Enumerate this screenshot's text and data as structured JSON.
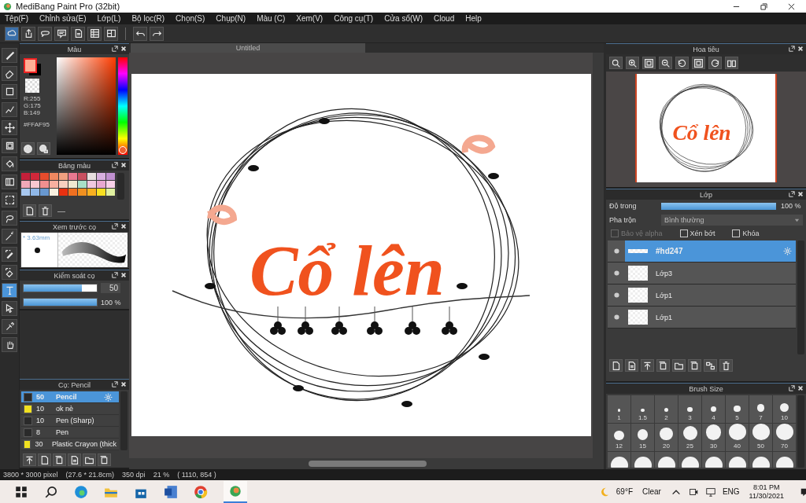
{
  "window": {
    "title": "MediBang Paint Pro (32bit)"
  },
  "menu": [
    "Tệp(F)",
    "Chỉnh sửa(E)",
    "Lớp(L)",
    "Bộ lọc(R)",
    "Chọn(S)",
    "Chụp(N)",
    "Màu (C)",
    "Xem(V)",
    "Công cụ(T)",
    "Cửa sổ(W)",
    "Cloud",
    "Help"
  ],
  "tools": [
    {
      "kind": "brush",
      "selected": false
    },
    {
      "kind": "eraser",
      "selected": false
    },
    {
      "kind": "rect",
      "selected": false
    },
    {
      "kind": "polyline",
      "selected": false
    },
    {
      "kind": "move",
      "selected": false
    },
    {
      "kind": "fillrect",
      "selected": false
    },
    {
      "kind": "bucket",
      "selected": false
    },
    {
      "kind": "gradient",
      "selected": false
    },
    {
      "kind": "selectrect",
      "selected": false
    },
    {
      "kind": "lasso",
      "selected": false
    },
    {
      "kind": "wand",
      "selected": false
    },
    {
      "kind": "selectpen",
      "selected": false
    },
    {
      "kind": "selecteraser",
      "selected": false
    },
    {
      "kind": "text",
      "selected": true
    },
    {
      "kind": "operation",
      "selected": false
    },
    {
      "kind": "dropper",
      "selected": false
    },
    {
      "kind": "hand",
      "selected": false
    }
  ],
  "color_panel": {
    "title": "Màu",
    "color": "#ffaf95",
    "r": "R:255",
    "g": "G:175",
    "b": "B:149",
    "hex": "#FFAF95"
  },
  "palette": {
    "title": "Bảng màu",
    "extra": "—",
    "swatches": [
      {
        "color": "#c4203a"
      },
      {
        "color": "#d0283a"
      },
      {
        "color": "#e84c2c"
      },
      {
        "color": "#f08860"
      },
      {
        "color": "#f0a080"
      },
      {
        "color": "#e87890"
      },
      {
        "color": "#c85060"
      },
      {
        "color": "#e8e0e0"
      },
      {
        "color": "#d8b0e0"
      },
      {
        "color": "#c090d0"
      },
      {
        "color": "#f0a8b8"
      },
      {
        "color": "#f8c8d0"
      },
      {
        "color": "#f09090"
      },
      {
        "color": "#f8b0a0"
      },
      {
        "color": "#f8d0c0"
      },
      {
        "color": "#f0e8d0"
      },
      {
        "color": "#a8e0c8"
      },
      {
        "color": "#f0c8e0"
      },
      {
        "color": "#e8a8d0"
      },
      {
        "color": "#f8d0e8"
      },
      {
        "color": "#a8c8f0"
      },
      {
        "color": "#90b8e8"
      },
      {
        "color": "#6898d0"
      },
      {
        "color": "#f8f0e0"
      },
      {
        "color": "#e83010"
      },
      {
        "color": "#f07020"
      },
      {
        "color": "#f09020"
      },
      {
        "color": "#f8b020"
      },
      {
        "color": "#f8e020"
      },
      {
        "color": "#e0f0a0"
      }
    ]
  },
  "brush_preview": {
    "title": "Xem trước cọ",
    "size": "* 3.63mm"
  },
  "brush_control": {
    "title": "Kiểm soát cọ",
    "size_slider": {
      "level": 0.8
    },
    "size": "50",
    "opacity_slider": {
      "level": 1
    },
    "opacity": "100 %"
  },
  "brush_list": {
    "title": "Cọ: Pencil",
    "items": [
      {
        "size": "50",
        "name": "Pencil",
        "color": "#2a2a2a",
        "selected": true
      },
      {
        "size": "10",
        "name": "ok nè",
        "color": "#f0e020",
        "selected": false
      },
      {
        "size": "10",
        "name": "Pen (Sharp)",
        "color": "#2a2a2a",
        "selected": false
      },
      {
        "size": "8",
        "name": "Pen",
        "color": "#2a2a2a",
        "selected": false
      },
      {
        "size": "30",
        "name": "Plastic Crayon (thick",
        "color": "#f0e020",
        "selected": false
      }
    ]
  },
  "canvas": {
    "tab": "Untitled",
    "artwork_text": "Cổ lên"
  },
  "navigator": {
    "title": "Hoa tiêu",
    "artwork_text": "Cổ lên"
  },
  "layers": {
    "title": "Lớp",
    "opacity_label": "Độ trong",
    "opacity_slider": {
      "level": 1
    },
    "opacity": "100 %",
    "blend_label": "Pha trộn",
    "blend": "Bình thường",
    "options": [
      {
        "label": "Bảo vệ alpha",
        "checked": false,
        "disabled": true
      },
      {
        "label": "Xén bớt",
        "checked": false,
        "disabled": false
      },
      {
        "label": "Khóa",
        "checked": false,
        "disabled": false
      }
    ],
    "items": [
      {
        "name": "#hd247",
        "visible": true,
        "selected": true
      },
      {
        "name": "Lớp3",
        "visible": true,
        "selected": false
      },
      {
        "name": "Lớp1",
        "visible": true,
        "selected": false
      },
      {
        "name": "Lớp1",
        "visible": true,
        "selected": false
      }
    ]
  },
  "brush_size": {
    "title": "Brush Size",
    "sizes": [
      "1",
      "1.5",
      "2",
      "3",
      "4",
      "5",
      "7",
      "10",
      "12",
      "15",
      "20",
      "25",
      "30",
      "40",
      "50",
      "70"
    ]
  },
  "status_bar": [
    "3800 * 3000 pixel",
    "(27.6 * 21.8cm)",
    "350 dpi",
    "21 %",
    "( 1110, 854 )"
  ],
  "taskbar": {
    "temperature": "69°F",
    "weather": "Clear",
    "language": "ENG",
    "time": "8:01 PM",
    "date": "11/30/2021"
  }
}
